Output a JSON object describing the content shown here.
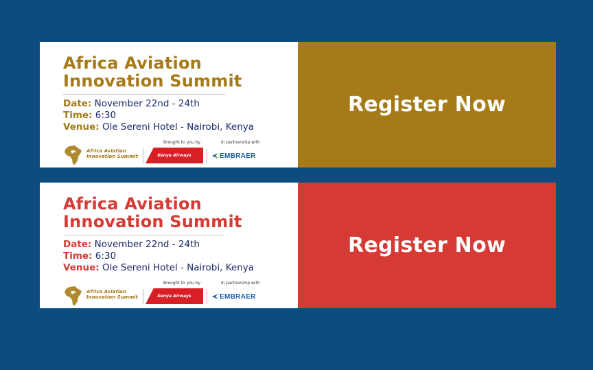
{
  "colors": {
    "page_bg": "#0e4c7e",
    "gold": "#a67a17",
    "red": "#d53a34",
    "navy_text": "#1b2a6b"
  },
  "banners": [
    {
      "variant": "gold",
      "accent": "#a67a17",
      "title_line1": "Africa Aviation",
      "title_line2": "Innovation Summit",
      "date_label": "Date:",
      "date_value": "November 22nd - 24th",
      "time_label": "Time:",
      "time_value": "6:30",
      "venue_label": "Venue:",
      "venue_value": "Ole Sereni Hotel - Nairobi, Kenya",
      "brought_caption": "Brought to you by",
      "partner_caption": "In partnership with",
      "summit_logo_line1": "Africa Aviation",
      "summit_logo_line2": "Innovation Summit",
      "sponsor_name": "Kenya Airways",
      "partner_name": "EMBRAER",
      "cta_label": "Register Now",
      "icons": [
        "africa-map-icon",
        "kenya-airways-logo",
        "embraer-logo"
      ]
    },
    {
      "variant": "red",
      "accent": "#d53a34",
      "title_line1": "Africa Aviation",
      "title_line2": "Innovation Summit",
      "date_label": "Date:",
      "date_value": "November 22nd - 24th",
      "time_label": "Time:",
      "time_value": "6:30",
      "venue_label": "Venue:",
      "venue_value": "Ole Sereni Hotel - Nairobi, Kenya",
      "brought_caption": "Brought to you by",
      "partner_caption": "In partnership with",
      "summit_logo_line1": "Africa Aviation",
      "summit_logo_line2": "Innovation Summit",
      "sponsor_name": "Kenya Airways",
      "partner_name": "EMBRAER",
      "cta_label": "Register Now",
      "icons": [
        "africa-map-icon",
        "kenya-airways-logo",
        "embraer-logo"
      ]
    }
  ]
}
